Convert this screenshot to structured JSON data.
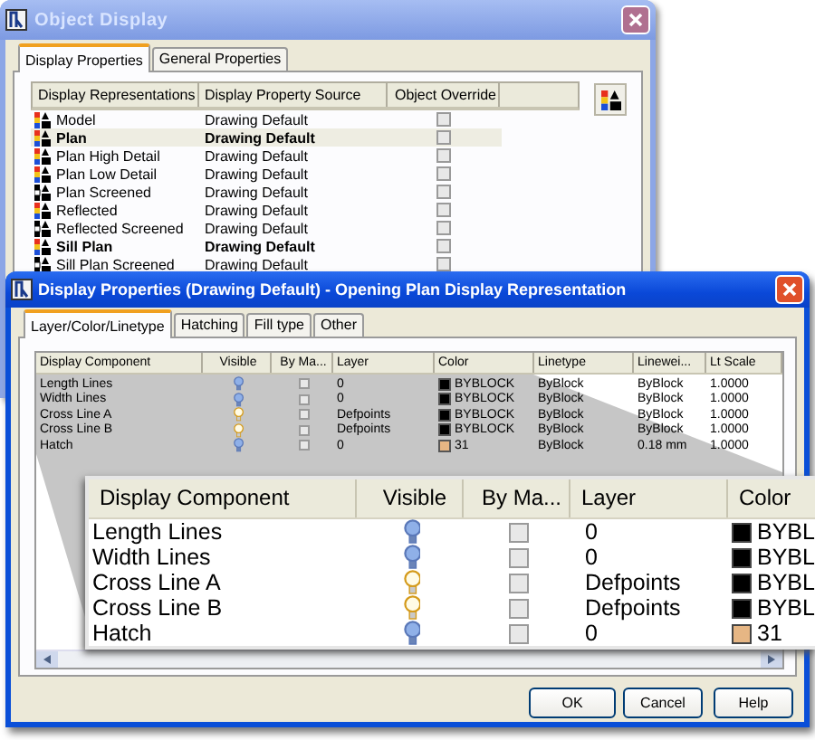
{
  "object_display": {
    "title": "Object Display",
    "tabs": [
      {
        "label": "Display Properties",
        "selected": true
      },
      {
        "label": "General Properties",
        "selected": false
      }
    ],
    "columns": [
      "Display Representations",
      "Display Property Source",
      "Object Override"
    ],
    "rows": [
      {
        "name": "Model",
        "source": "Drawing Default",
        "active": false,
        "screened": false,
        "override": false,
        "selected": false
      },
      {
        "name": "Plan",
        "source": "Drawing Default",
        "active": true,
        "screened": false,
        "override": false,
        "selected": true
      },
      {
        "name": "Plan High Detail",
        "source": "Drawing Default",
        "active": false,
        "screened": false,
        "override": false,
        "selected": false
      },
      {
        "name": "Plan Low Detail",
        "source": "Drawing Default",
        "active": false,
        "screened": false,
        "override": false,
        "selected": false
      },
      {
        "name": "Plan Screened",
        "source": "Drawing Default",
        "active": false,
        "screened": true,
        "override": false,
        "selected": false
      },
      {
        "name": "Reflected",
        "source": "Drawing Default",
        "active": false,
        "screened": false,
        "override": false,
        "selected": false
      },
      {
        "name": "Reflected Screened",
        "source": "Drawing Default",
        "active": false,
        "screened": true,
        "override": false,
        "selected": false
      },
      {
        "name": "Sill Plan",
        "source": "Drawing Default",
        "active": true,
        "screened": false,
        "override": false,
        "selected": false
      },
      {
        "name": "Sill Plan Screened",
        "source": "Drawing Default",
        "active": false,
        "screened": true,
        "override": false,
        "selected": false
      }
    ]
  },
  "display_properties": {
    "title": "Display Properties (Drawing Default) - Opening Plan Display Representation",
    "tabs": [
      {
        "label": "Layer/Color/Linetype",
        "selected": true
      },
      {
        "label": "Hatching",
        "selected": false
      },
      {
        "label": "Fill type",
        "selected": false
      },
      {
        "label": "Other",
        "selected": false
      }
    ],
    "columns": [
      "Display Component",
      "Visible",
      "By Ma...",
      "Layer",
      "Color",
      "Linetype",
      "Linewei...",
      "Lt Scale"
    ],
    "rows": [
      {
        "component": "Length Lines",
        "visible": false,
        "by_material": false,
        "layer": "0",
        "color": "#000000",
        "color_label": "BYBLOCK",
        "linetype": "ByBlock",
        "lineweight": "ByBlock",
        "lt_scale": "1.0000"
      },
      {
        "component": "Width Lines",
        "visible": false,
        "by_material": false,
        "layer": "0",
        "color": "#000000",
        "color_label": "BYBLOCK",
        "linetype": "ByBlock",
        "lineweight": "ByBlock",
        "lt_scale": "1.0000"
      },
      {
        "component": "Cross Line A",
        "visible": true,
        "by_material": false,
        "layer": "Defpoints",
        "color": "#000000",
        "color_label": "BYBLOCK",
        "linetype": "ByBlock",
        "lineweight": "ByBlock",
        "lt_scale": "1.0000"
      },
      {
        "component": "Cross Line B",
        "visible": true,
        "by_material": false,
        "layer": "Defpoints",
        "color": "#000000",
        "color_label": "BYBLOCK",
        "linetype": "ByBlock",
        "lineweight": "ByBlock",
        "lt_scale": "1.0000"
      },
      {
        "component": "Hatch",
        "visible": false,
        "by_material": false,
        "layer": "0",
        "color": "#e6b684",
        "color_label": "31",
        "linetype": "ByBlock",
        "lineweight": "0.18 mm",
        "lt_scale": "1.0000"
      }
    ],
    "buttons": [
      "OK",
      "Cancel",
      "Help"
    ]
  },
  "magnified_table": {
    "columns": [
      "Display Component",
      "Visible",
      "By Ma...",
      "Layer",
      "Color"
    ],
    "rows": [
      {
        "component": "Length Lines",
        "visible": false,
        "by_material": false,
        "layer": "0",
        "color": "#000000",
        "color_label": "BYBL"
      },
      {
        "component": "Width Lines",
        "visible": false,
        "by_material": false,
        "layer": "0",
        "color": "#000000",
        "color_label": "BYBL"
      },
      {
        "component": "Cross Line A",
        "visible": true,
        "by_material": false,
        "layer": "Defpoints",
        "color": "#000000",
        "color_label": "BYBL"
      },
      {
        "component": "Cross Line B",
        "visible": true,
        "by_material": false,
        "layer": "Defpoints",
        "color": "#000000",
        "color_label": "BYBL"
      },
      {
        "component": "Hatch",
        "visible": false,
        "by_material": false,
        "layer": "0",
        "color": "#e6b684",
        "color_label": "31"
      }
    ]
  }
}
